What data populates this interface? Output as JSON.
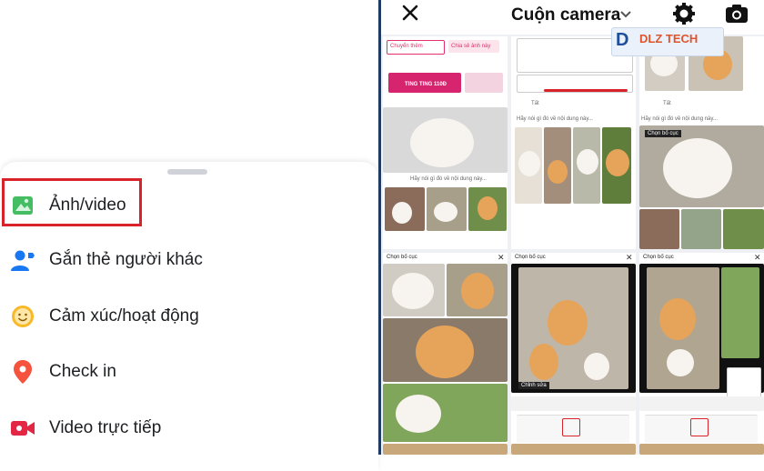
{
  "left_panel": {
    "menu": [
      {
        "label": "Ảnh/video",
        "icon": "photo-video-icon",
        "color": "#45bd62"
      },
      {
        "label": "Gắn thẻ người khác",
        "icon": "tag-people-icon",
        "color": "#1877f2"
      },
      {
        "label": "Cảm xúc/hoạt động",
        "icon": "feeling-emoji-icon",
        "color": "#f7b928"
      },
      {
        "label": "Check in",
        "icon": "location-pin-icon",
        "color": "#f5533d"
      },
      {
        "label": "Video trực tiếp",
        "icon": "live-video-icon",
        "color": "#e42645"
      }
    ],
    "highlight_color": "#d8232a"
  },
  "right_panel": {
    "title": "Cuộn camera",
    "logo_text": "DLZ TECH",
    "grid_snippets": {
      "prompt": "Hãy nói gì đó về nội dung này...",
      "choose_layout": "Chọn bố cục",
      "edit": "Chỉnh sửa",
      "size_label": "Tất",
      "explore": "Chuyển thêm",
      "share": "Chia sẻ ảnh này",
      "promo": "TING TING 110Đ"
    }
  }
}
